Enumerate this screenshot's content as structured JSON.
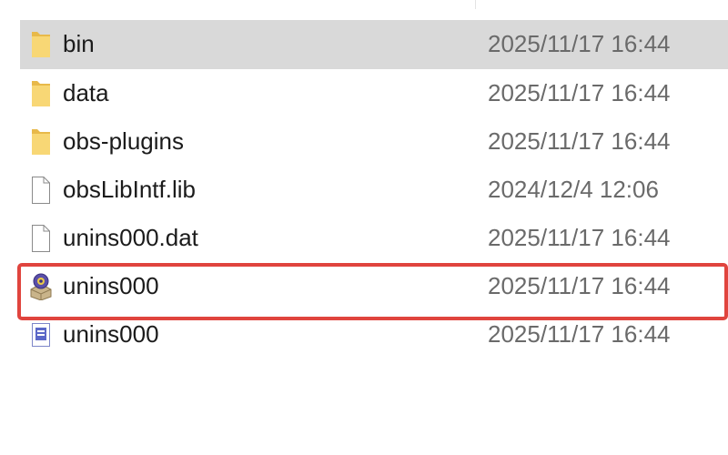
{
  "files": [
    {
      "name": "bin",
      "date": "2025/11/17 16:44",
      "icon": "folder-icon",
      "selected": true
    },
    {
      "name": "data",
      "date": "2025/11/17 16:44",
      "icon": "folder-icon",
      "selected": false
    },
    {
      "name": "obs-plugins",
      "date": "2025/11/17 16:44",
      "icon": "folder-icon",
      "selected": false
    },
    {
      "name": "obsLibIntf.lib",
      "date": "2024/12/4 12:06",
      "icon": "blank-file-icon",
      "selected": false
    },
    {
      "name": "unins000.dat",
      "date": "2025/11/17 16:44",
      "icon": "blank-file-icon",
      "selected": false
    },
    {
      "name": "unins000",
      "date": "2025/11/17 16:44",
      "icon": "uninstaller-app-icon",
      "selected": false
    },
    {
      "name": "unins000",
      "date": "2025/11/17 16:44",
      "icon": "message-file-icon",
      "selected": false
    }
  ],
  "colors": {
    "selection": "#d9d9d9",
    "highlight_border": "#e0443e",
    "folder": "#f8d775",
    "date_text": "#6a6a6a"
  }
}
